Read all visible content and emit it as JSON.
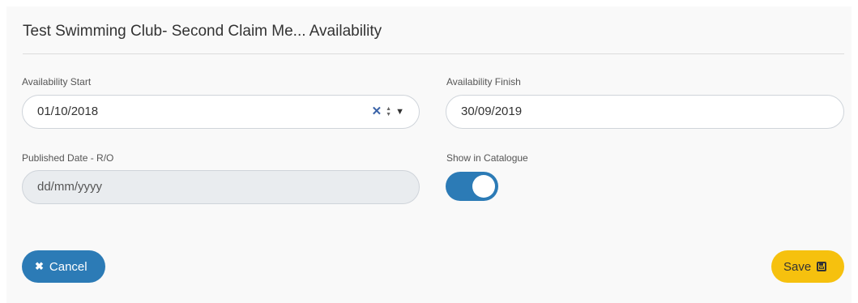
{
  "header": {
    "title": "Test Swimming Club- Second Claim Me... Availability"
  },
  "form": {
    "availability_start": {
      "label": "Availability Start",
      "value": "01/10/2018"
    },
    "availability_finish": {
      "label": "Availability Finish",
      "value": "30/09/2019"
    },
    "published_date": {
      "label": "Published Date - R/O",
      "value": "dd/mm/yyyy"
    },
    "show_in_catalogue": {
      "label": "Show in Catalogue",
      "checked": true
    }
  },
  "buttons": {
    "cancel_label": "Cancel",
    "save_label": "Save"
  },
  "icons": {
    "cancel": "times-icon",
    "save": "floppy-disk-icon",
    "clear": "clear-x-icon",
    "spinner": "spinner-arrows-icon",
    "dropdown": "dropdown-caret-icon"
  },
  "colors": {
    "primary": "#2c7bb6",
    "save": "#f6c10e",
    "clear_icon": "#3a63a8"
  }
}
